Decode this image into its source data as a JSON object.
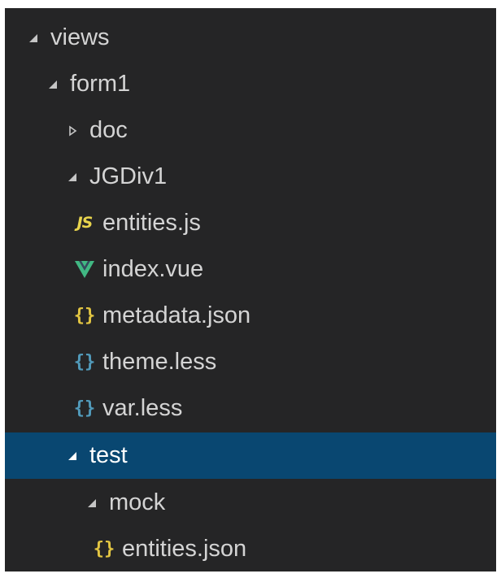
{
  "explorer": {
    "items": [
      {
        "label": "views",
        "type": "folder",
        "expanded": true
      },
      {
        "label": "form1",
        "type": "folder",
        "expanded": true
      },
      {
        "label": "doc",
        "type": "folder",
        "expanded": false
      },
      {
        "label": "JGDiv1",
        "type": "folder",
        "expanded": true
      },
      {
        "label": "entities.js",
        "type": "file",
        "icon": "js-file-icon",
        "icon_text": "JS"
      },
      {
        "label": "index.vue",
        "type": "file",
        "icon": "vue-file-icon"
      },
      {
        "label": "metadata.json",
        "type": "file",
        "icon": "json-file-icon",
        "icon_text": "{}"
      },
      {
        "label": "theme.less",
        "type": "file",
        "icon": "less-file-icon",
        "icon_text": "{}"
      },
      {
        "label": "var.less",
        "type": "file",
        "icon": "less-file-icon",
        "icon_text": "{}"
      },
      {
        "label": "test",
        "type": "folder",
        "expanded": true,
        "selected": true
      },
      {
        "label": "mock",
        "type": "folder",
        "expanded": true
      },
      {
        "label": "entities.json",
        "type": "file",
        "icon": "json-file-icon",
        "icon_text": "{}"
      }
    ]
  },
  "colors": {
    "background": "#252526",
    "selection": "#094771",
    "text": "#d4d4d4",
    "js_icon": "#e8d44d",
    "json_icon": "#e2c542",
    "less_icon": "#519aba",
    "vue_icon": "#41b883"
  }
}
